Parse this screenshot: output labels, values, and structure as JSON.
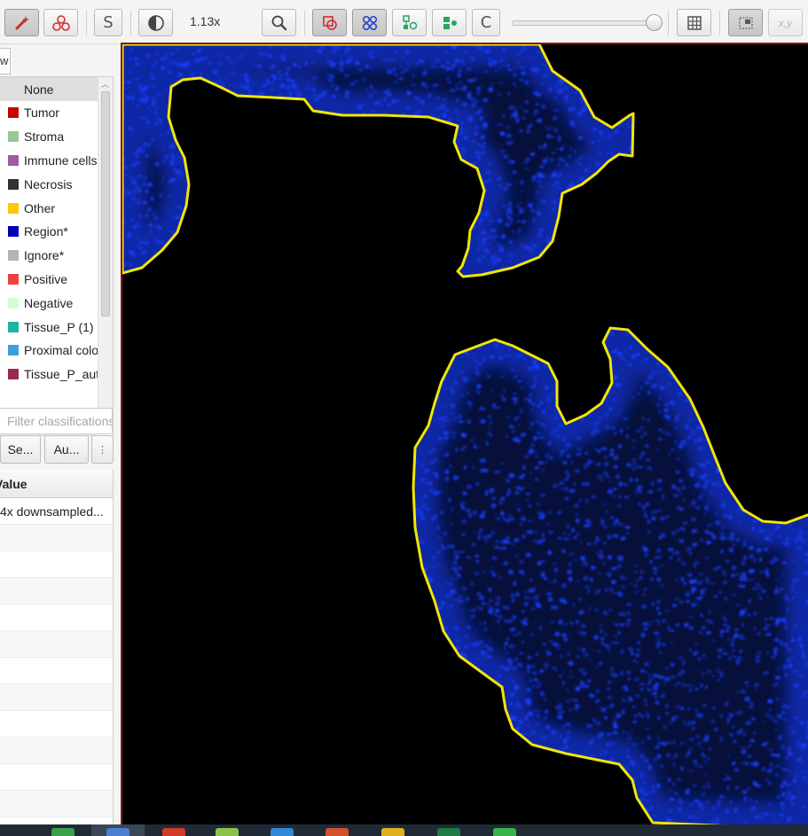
{
  "toolbar": {
    "zoom_label": "1.13x",
    "letter_s": "S",
    "letter_c": "C",
    "xy_label": "x,y",
    "icons": [
      "wand-icon",
      "brush-icon",
      "contrast-icon",
      "zoom-icon",
      "annotations-icon",
      "cells-icon",
      "objects-icon",
      "classification-icon",
      "grid-icon",
      "overview-icon",
      "location-icon"
    ],
    "active_color": "#c8c8c8",
    "accent_red": "#d22e2e",
    "accent_blue": "#2040c8",
    "accent_green": "#27a560"
  },
  "left_panel": {
    "partial_tab": "w",
    "classes": [
      {
        "label": "None",
        "color": "",
        "selected": true
      },
      {
        "label": "Tumor",
        "color": "#c80000"
      },
      {
        "label": "Stroma",
        "color": "#96c896"
      },
      {
        "label": "Immune cells",
        "color": "#a05aa0"
      },
      {
        "label": "Necrosis",
        "color": "#323232"
      },
      {
        "label": "Other",
        "color": "#ffc800"
      },
      {
        "label": "Region*",
        "color": "#0000b4"
      },
      {
        "label": "Ignore*",
        "color": "#b4b4b4"
      },
      {
        "label": "Positive",
        "color": "#f04040"
      },
      {
        "label": "Negative",
        "color": "#d2ffd2"
      },
      {
        "label": "Tissue_P (1)",
        "color": "#1fb49b"
      },
      {
        "label": "Proximal colon",
        "color": "#3ca0dc"
      },
      {
        "label": "Tissue_P_auto",
        "color": "#962d50"
      }
    ],
    "filter_placeholder": "Filter classifications",
    "buttons": {
      "set": "Se...",
      "auto": "Au...",
      "more": "⋮"
    },
    "table_header": "Value",
    "table_rows": [
      "4x downsampled...",
      "",
      "",
      "",
      "",
      "",
      "",
      "",
      "",
      "",
      "",
      ""
    ]
  },
  "viewer": {
    "annotation_color": "#f2e600",
    "nuclei_color": "#1a3dff",
    "border_color": "#8b1a1a"
  },
  "taskbar": {
    "icon_colors": [
      "#3aa04a",
      "#4b7fd1",
      "#d23a2a",
      "#8bc34a",
      "#2f87d6",
      "#d4502a",
      "#e0b020",
      "#1f7a45",
      "#37b34a"
    ]
  }
}
